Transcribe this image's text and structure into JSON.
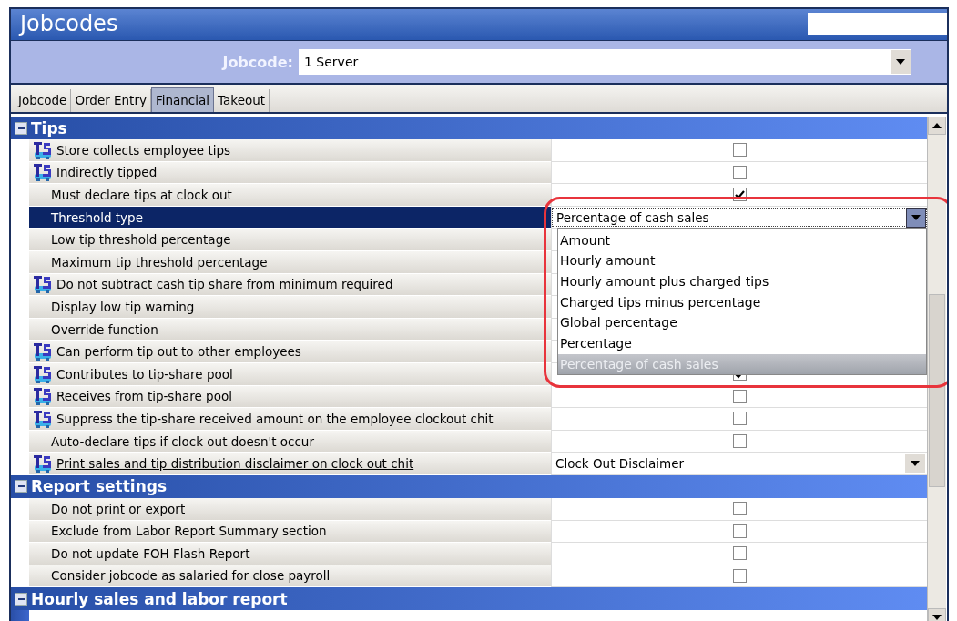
{
  "window": {
    "title": "Jobcodes"
  },
  "jobcode": {
    "label": "Jobcode:",
    "value": "1 Server"
  },
  "tabs": [
    {
      "label": "Jobcode",
      "selected": false
    },
    {
      "label": "Order Entry",
      "selected": false
    },
    {
      "label": "Financial",
      "selected": true
    },
    {
      "label": "Takeout",
      "selected": false
    }
  ],
  "sections": [
    {
      "title": "Tips",
      "expanded": true,
      "rows": [
        {
          "label": "Store collects employee tips",
          "ts": true,
          "kind": "checkbox",
          "checked": false,
          "selected": false
        },
        {
          "label": "Indirectly tipped",
          "ts": true,
          "kind": "checkbox",
          "checked": false,
          "selected": false
        },
        {
          "label": "Must declare tips at clock out",
          "ts": false,
          "kind": "checkbox",
          "checked": true,
          "selected": false
        },
        {
          "label": "Threshold type",
          "ts": false,
          "kind": "open-select",
          "value": "Percentage of cash sales",
          "selected": true,
          "options": [
            {
              "label": "Amount",
              "selected": false
            },
            {
              "label": "Hourly amount",
              "selected": false
            },
            {
              "label": "Hourly amount plus charged tips",
              "selected": false
            },
            {
              "label": "Charged tips minus percentage",
              "selected": false
            },
            {
              "label": "Global percentage",
              "selected": false
            },
            {
              "label": "Percentage",
              "selected": false
            },
            {
              "label": "Percentage of cash sales",
              "selected": true
            }
          ]
        },
        {
          "label": "Low tip threshold percentage",
          "ts": false,
          "kind": "hidden",
          "selected": false
        },
        {
          "label": "Maximum tip threshold percentage",
          "ts": false,
          "kind": "hidden",
          "selected": false
        },
        {
          "label": "Do not subtract cash tip share from minimum required",
          "ts": true,
          "kind": "hidden",
          "selected": false
        },
        {
          "label": "Display low tip warning",
          "ts": false,
          "kind": "hidden",
          "selected": false
        },
        {
          "label": "Override function",
          "ts": false,
          "kind": "hidden",
          "selected": false
        },
        {
          "label": "Can perform tip out to other employees",
          "ts": true,
          "kind": "hidden",
          "selected": false
        },
        {
          "label": "Contributes to tip-share pool",
          "ts": true,
          "kind": "checkbox",
          "checked": true,
          "selected": false
        },
        {
          "label": "Receives from tip-share pool",
          "ts": true,
          "kind": "checkbox",
          "checked": false,
          "selected": false
        },
        {
          "label": "Suppress the tip-share received amount on the employee clockout chit",
          "ts": true,
          "kind": "checkbox",
          "checked": false,
          "selected": false
        },
        {
          "label": "Auto-declare tips if clock out doesn't occur",
          "ts": false,
          "kind": "checkbox",
          "checked": false,
          "selected": false
        },
        {
          "label": "Print sales and tip distribution disclaimer on clock out chit",
          "ts": true,
          "underlined": true,
          "kind": "select",
          "value": "Clock Out Disclaimer",
          "selected": false
        }
      ]
    },
    {
      "title": "Report settings",
      "expanded": true,
      "rows": [
        {
          "label": "Do not print or export",
          "ts": false,
          "kind": "checkbox",
          "checked": false,
          "selected": false
        },
        {
          "label": "Exclude from Labor Report Summary section",
          "ts": false,
          "kind": "checkbox",
          "checked": false,
          "selected": false
        },
        {
          "label": "Do not update FOH Flash Report",
          "ts": false,
          "kind": "checkbox",
          "checked": false,
          "selected": false
        },
        {
          "label": "Consider jobcode as salaried for close payroll",
          "ts": false,
          "kind": "checkbox",
          "checked": false,
          "selected": false
        }
      ]
    },
    {
      "title": "Hourly sales and labor report",
      "expanded": true
    }
  ],
  "callout": {
    "kind": "outline"
  }
}
